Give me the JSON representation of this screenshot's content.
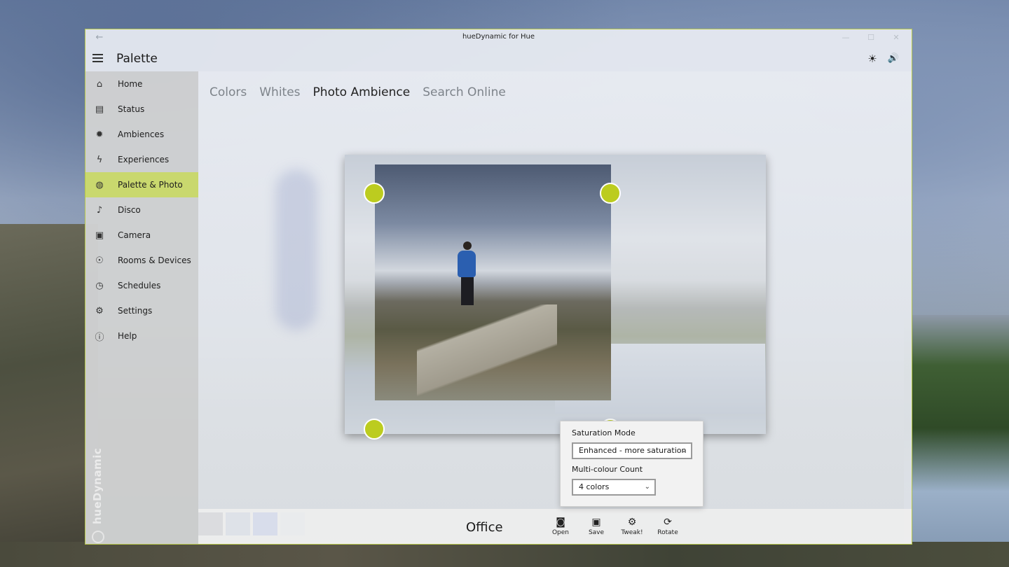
{
  "app": {
    "title": "hueDynamic for Hue",
    "page_title": "Palette",
    "brand": "hueDynamic"
  },
  "titlebar": {
    "back_glyph": "←",
    "minimize_glyph": "—",
    "maximize_glyph": "☐",
    "close_glyph": "✕"
  },
  "header_icons": {
    "brightness": "☀",
    "volume": "🔊"
  },
  "sidebar": {
    "items": [
      {
        "label": "Home",
        "icon": "⌂",
        "icon_name": "home-icon"
      },
      {
        "label": "Status",
        "icon": "▤",
        "icon_name": "status-icon"
      },
      {
        "label": "Ambiences",
        "icon": "✹",
        "icon_name": "ambiences-icon"
      },
      {
        "label": "Experiences",
        "icon": "ϟ",
        "icon_name": "experiences-icon"
      },
      {
        "label": "Palette & Photo",
        "icon": "◍",
        "icon_name": "palette-icon",
        "active": true
      },
      {
        "label": "Disco",
        "icon": "♪",
        "icon_name": "disco-icon"
      },
      {
        "label": "Camera",
        "icon": "▣",
        "icon_name": "camera-icon"
      },
      {
        "label": "Rooms & Devices",
        "icon": "☉",
        "icon_name": "bulb-icon"
      },
      {
        "label": "Schedules",
        "icon": "◷",
        "icon_name": "clock-icon"
      },
      {
        "label": "Settings",
        "icon": "⚙",
        "icon_name": "gear-icon"
      },
      {
        "label": "Help",
        "icon": "ⓘ",
        "icon_name": "info-icon"
      }
    ]
  },
  "tabs": [
    {
      "label": "Colors",
      "active": false
    },
    {
      "label": "Whites",
      "active": false
    },
    {
      "label": "Photo Ambience",
      "active": true
    },
    {
      "label": "Search Online",
      "active": false
    }
  ],
  "palette_swatches": [
    "#2f3850",
    "#4a6fae",
    "#0a3fc9",
    "#b9c9e2"
  ],
  "accent_color": "#bccc1f",
  "bottom_bar": {
    "scene_name": "Office",
    "commands": [
      {
        "label": "Open",
        "icon": "◙",
        "icon_name": "camera-open-icon"
      },
      {
        "label": "Save",
        "icon": "▣",
        "icon_name": "save-icon"
      },
      {
        "label": "Tweak!",
        "icon": "⚙",
        "icon_name": "tweak-gear-icon"
      },
      {
        "label": "Rotate",
        "icon": "⟳",
        "icon_name": "rotate-icon"
      }
    ]
  },
  "flyout": {
    "saturation_label": "Saturation Mode",
    "saturation_value": "Enhanced - more saturation",
    "count_label": "Multi-colour Count",
    "count_value": "4 colors"
  }
}
